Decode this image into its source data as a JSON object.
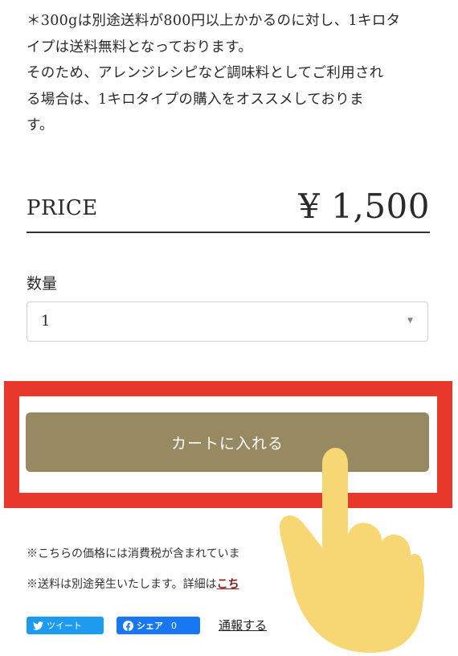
{
  "description": {
    "line1": "＊300gは別途送料が800円以上かかるのに対し、1キロタ",
    "line2": "イプは送料無料となっております。",
    "line3": "そのため、アレンジレシピなど調味料としてご利用され",
    "line4": "る場合は、1キロタイプの購入をオススメしておりま",
    "line5": "す。"
  },
  "price": {
    "label": "PRICE",
    "value": "¥ 1,500"
  },
  "quantity": {
    "label": "数量",
    "selected": "1"
  },
  "cart": {
    "button_label": "カートに入れる"
  },
  "notes": {
    "tax": "※こちらの価格には消費税が含まれていま",
    "shipping_prefix": "※送料は別途発生いたします。詳細は",
    "shipping_link": "こち"
  },
  "social": {
    "tweet_label": "ツイート",
    "share_label": "シェア",
    "share_count": "0",
    "report_label": "通報する"
  },
  "colors": {
    "cart_button": "#978a63",
    "highlight_border": "#e8372b",
    "twitter": "#1d9bf0",
    "facebook": "#1877f2",
    "hand": "#f7d774"
  }
}
